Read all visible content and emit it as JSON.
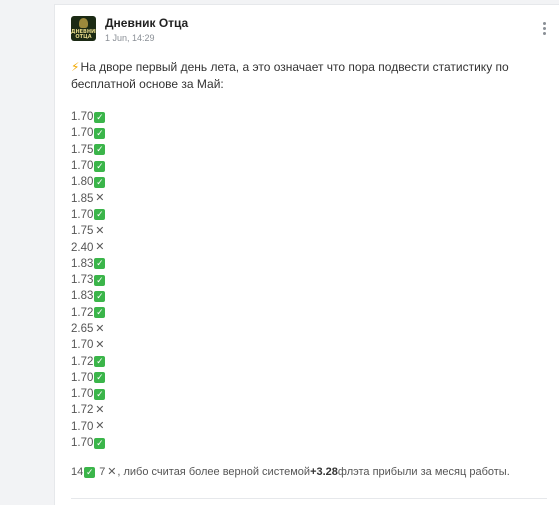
{
  "post": {
    "channel_name": "Дневник Отца",
    "avatar_text": "ДНЕВНИК ОТЦА",
    "time": "1 Jun, 14:29",
    "intro": "На дворе первый день лета, а это означает что пора подвести статистику по бесплатной основе за Май:",
    "results": [
      {
        "odds": "1.70",
        "win": true
      },
      {
        "odds": "1.70",
        "win": true
      },
      {
        "odds": "1.75",
        "win": true
      },
      {
        "odds": "1.70",
        "win": true
      },
      {
        "odds": "1.80",
        "win": true
      },
      {
        "odds": "1.85",
        "win": false
      },
      {
        "odds": "1.70",
        "win": true
      },
      {
        "odds": "1.75",
        "win": false
      },
      {
        "odds": "2.40",
        "win": false
      },
      {
        "odds": "1.83",
        "win": true
      },
      {
        "odds": "1.73",
        "win": true
      },
      {
        "odds": "1.83",
        "win": true
      },
      {
        "odds": "1.72",
        "win": true
      },
      {
        "odds": "2.65",
        "win": false
      },
      {
        "odds": "1.70",
        "win": false
      },
      {
        "odds": "1.72",
        "win": true
      },
      {
        "odds": "1.70",
        "win": true
      },
      {
        "odds": "1.70",
        "win": true
      },
      {
        "odds": "1.72",
        "win": false
      },
      {
        "odds": "1.70",
        "win": false
      },
      {
        "odds": "1.70",
        "win": true
      }
    ],
    "summary": {
      "wins": "14",
      "losses": "7",
      "text_before": ", либо считая более верной системой ",
      "profit": "+3.28",
      "text_after": " флэта прибыли за месяц работы."
    }
  },
  "icons": {
    "intro_icon": "lightning-icon",
    "win_icon": "check-mark-icon",
    "loss_icon": "cross-mark-icon",
    "menu_icon": "more-vertical-icon"
  },
  "colors": {
    "win": "#3bb54a",
    "loss": "#5a5a5a",
    "bolt": "#f2a900"
  }
}
